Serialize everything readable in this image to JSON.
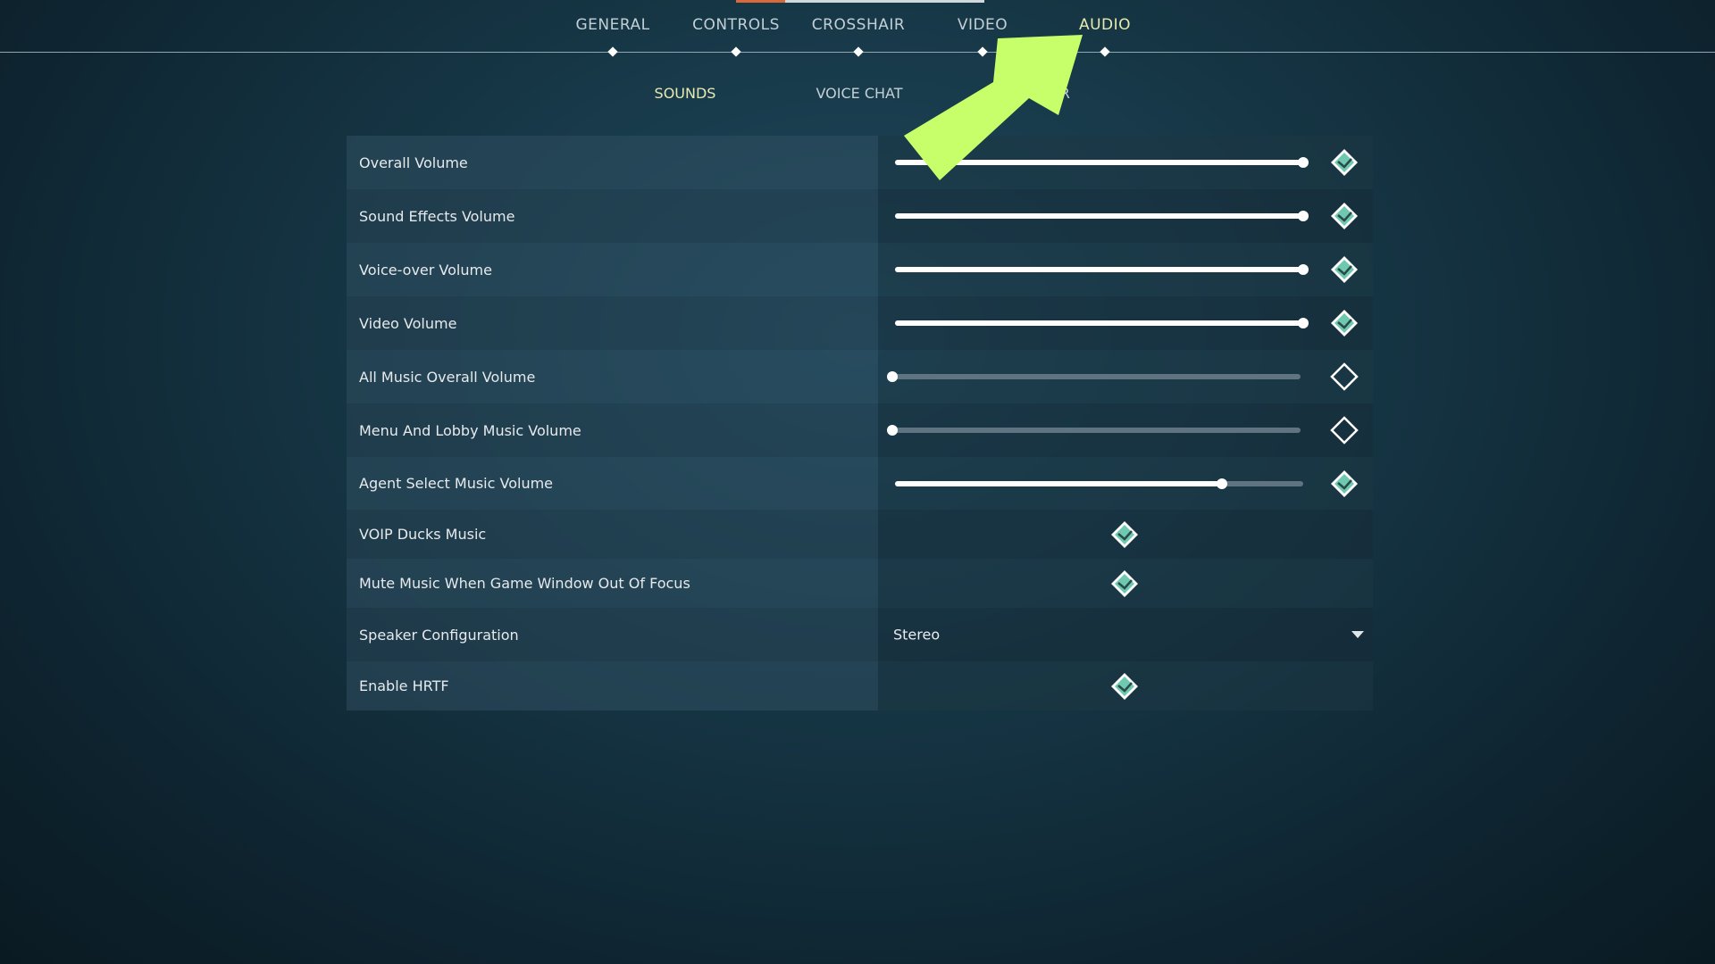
{
  "tabs": [
    {
      "label": "GENERAL"
    },
    {
      "label": "CONTROLS"
    },
    {
      "label": "CROSSHAIR"
    },
    {
      "label": "VIDEO"
    },
    {
      "label": "AUDIO",
      "active": true
    }
  ],
  "subtabs": [
    {
      "label": "SOUNDS",
      "active": true
    },
    {
      "label": "VOICE CHAT"
    },
    {
      "label": "OTHER"
    }
  ],
  "settings": [
    {
      "label": "Overall Volume",
      "type": "slider",
      "value": 1.0,
      "checked": true
    },
    {
      "label": "Sound Effects Volume",
      "type": "slider",
      "value": 1.0,
      "checked": true
    },
    {
      "label": "Voice-over Volume",
      "type": "slider",
      "value": 1.0,
      "checked": true
    },
    {
      "label": "Video Volume",
      "type": "slider",
      "value": 1.0,
      "checked": true
    },
    {
      "label": "All Music Overall Volume",
      "type": "slider",
      "value": 0.0,
      "checked": false
    },
    {
      "label": "Menu And Lobby Music Volume",
      "type": "slider",
      "value": 0.0,
      "checked": false
    },
    {
      "label": "Agent Select Music Volume",
      "type": "slider",
      "value": 0.8,
      "checked": true
    },
    {
      "label": "VOIP Ducks Music",
      "type": "checkbox",
      "checked": true
    },
    {
      "label": "Mute Music When Game Window Out Of Focus",
      "type": "checkbox",
      "checked": true
    },
    {
      "label": "Speaker Configuration",
      "type": "dropdown",
      "value": "Stereo"
    },
    {
      "label": "Enable HRTF",
      "type": "checkbox",
      "checked": true
    }
  ],
  "colors": {
    "accent": "#e6eab0",
    "checkbox_fill": "#6fc9b0",
    "annotation_arrow": "#c6ff6a",
    "tab_underline": "#d9683a"
  },
  "icons": {
    "checked": "diamond-check-icon",
    "unchecked": "diamond-empty-icon",
    "dropdown": "caret-down-icon",
    "annotation": "pointer-arrow-icon"
  }
}
